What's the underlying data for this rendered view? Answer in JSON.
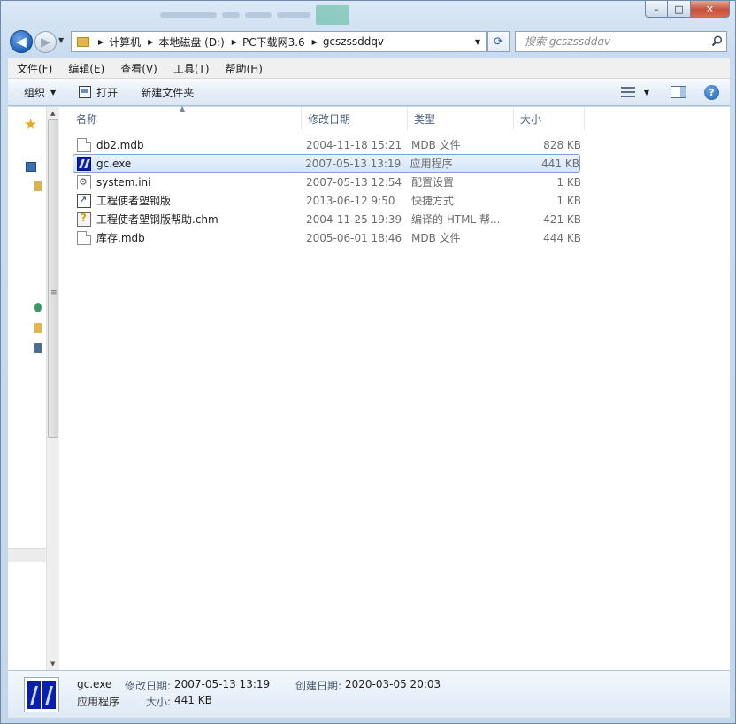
{
  "window": {
    "caption": {
      "minimize": "–",
      "maximize": "□",
      "close": "✕"
    }
  },
  "address": {
    "crumbs": [
      "计算机",
      "本地磁盘 (D:)",
      "PC下载网3.6",
      "gcszssddqv"
    ]
  },
  "search": {
    "placeholder": "搜索 gcszssddqv"
  },
  "menu": [
    "文件(F)",
    "编辑(E)",
    "查看(V)",
    "工具(T)",
    "帮助(H)"
  ],
  "toolbar": {
    "organize": "组织",
    "open": "打开",
    "new_folder": "新建文件夹"
  },
  "columns": {
    "name": "名称",
    "date": "修改日期",
    "type": "类型",
    "size": "大小"
  },
  "files": [
    {
      "name": "db2.mdb",
      "date": "2004-11-18 15:21",
      "type": "MDB 文件",
      "size": "828 KB",
      "icon": "document-icon"
    },
    {
      "name": "gc.exe",
      "date": "2007-05-13 13:19",
      "type": "应用程序",
      "size": "441 KB",
      "icon": "application-icon"
    },
    {
      "name": "system.ini",
      "date": "2007-05-13 12:54",
      "type": "配置设置",
      "size": "1 KB",
      "icon": "settings-file-icon"
    },
    {
      "name": "工程使者塑钢版",
      "date": "2013-06-12 9:50",
      "type": "快捷方式",
      "size": "1 KB",
      "icon": "shortcut-icon"
    },
    {
      "name": "工程使者塑钢版帮助.chm",
      "date": "2004-11-25 19:39",
      "type": "编译的 HTML 帮...",
      "size": "421 KB",
      "icon": "help-file-icon"
    },
    {
      "name": "库存.mdb",
      "date": "2005-06-01 18:46",
      "type": "MDB 文件",
      "size": "444 KB",
      "icon": "document-icon"
    }
  ],
  "selected_index": 1,
  "details": {
    "name": "gc.exe",
    "type": "应用程序",
    "modified_label": "修改日期:",
    "modified_value": "2007-05-13 13:19",
    "created_label": "创建日期:",
    "created_value": "2020-03-05 20:03",
    "size_label": "大小:",
    "size_value": "441 KB"
  },
  "colors": {
    "selection": "#d3e6fb",
    "selection_border": "#7da2ce",
    "accent": "#1d5fb8"
  }
}
